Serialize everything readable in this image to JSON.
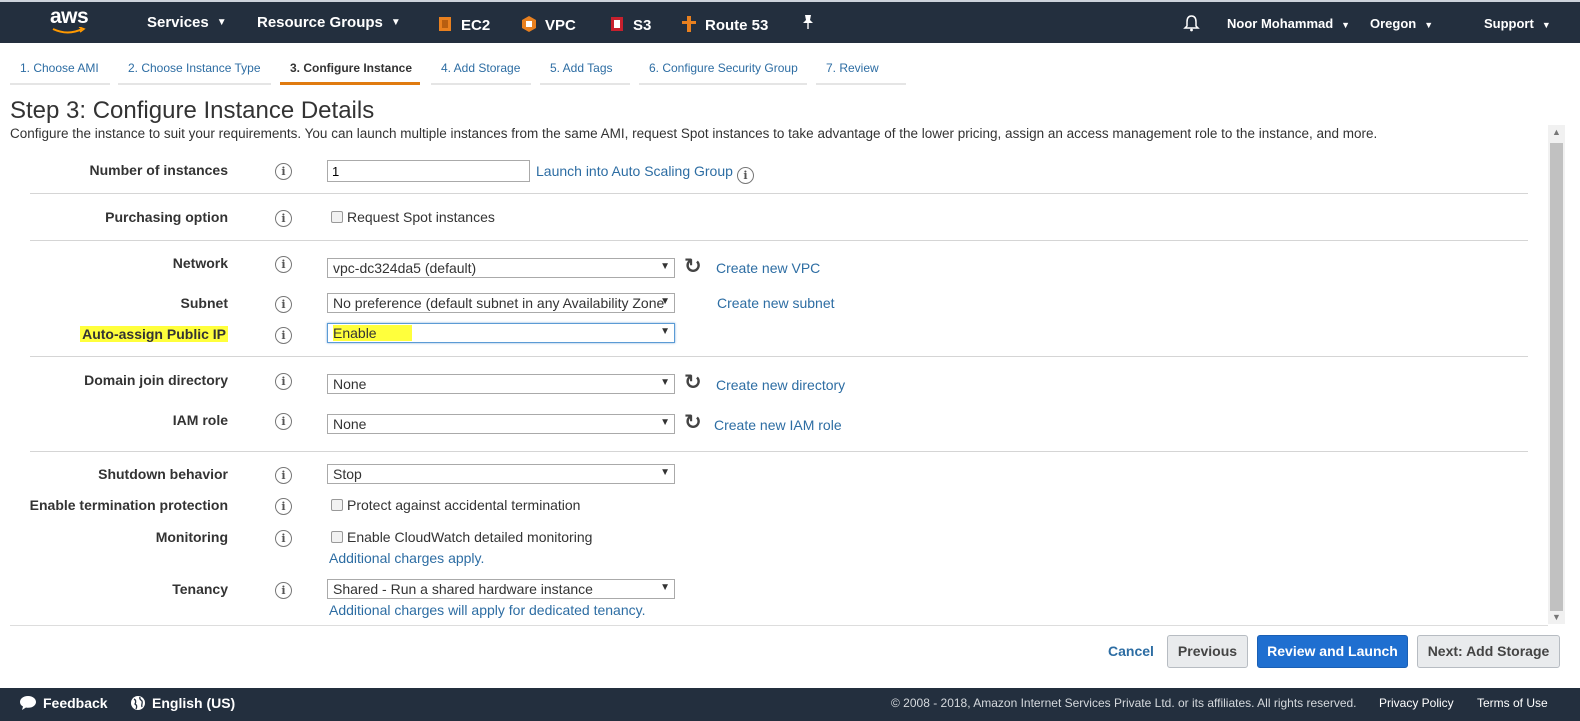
{
  "topnav": {
    "logo": "aws",
    "services": "Services",
    "resource_groups": "Resource Groups",
    "ec2": "EC2",
    "vpc": "VPC",
    "s3": "S3",
    "route53": "Route 53",
    "user": "Noor Mohammad",
    "region": "Oregon",
    "support": "Support",
    "icons": {
      "pin": "pin-icon",
      "bell": "bell-icon"
    }
  },
  "tabs": [
    "1. Choose AMI",
    "2. Choose Instance Type",
    "3. Configure Instance",
    "4. Add Storage",
    "5. Add Tags",
    "6. Configure Security Group",
    "7. Review"
  ],
  "page": {
    "title": "Step 3: Configure Instance Details",
    "description": "Configure the instance to suit your requirements. You can launch multiple instances from the same AMI, request Spot instances to take advantage of the lower pricing, assign an access management role to the instance, and more."
  },
  "form": {
    "num_instances": {
      "label": "Number of instances",
      "value": "1",
      "link": "Launch into Auto Scaling Group"
    },
    "purchasing": {
      "label": "Purchasing option",
      "checkbox": "Request Spot instances"
    },
    "network": {
      "label": "Network",
      "value": "vpc-dc324da5 (default)",
      "link": "Create new VPC"
    },
    "subnet": {
      "label": "Subnet",
      "value": "No preference (default subnet in any Availability Zone",
      "link": "Create new subnet"
    },
    "public_ip": {
      "label": "Auto-assign Public IP",
      "value": "Enable"
    },
    "domain": {
      "label": "Domain join directory",
      "value": "None",
      "link": "Create new directory"
    },
    "iam": {
      "label": "IAM role",
      "value": "None",
      "link": "Create new IAM role"
    },
    "shutdown": {
      "label": "Shutdown behavior",
      "value": "Stop"
    },
    "termination": {
      "label": "Enable termination protection",
      "checkbox": "Protect against accidental termination"
    },
    "monitoring": {
      "label": "Monitoring",
      "checkbox": "Enable CloudWatch detailed monitoring",
      "note": "Additional charges apply."
    },
    "tenancy": {
      "label": "Tenancy",
      "value": "Shared - Run a shared hardware instance",
      "note": "Additional charges will apply for dedicated tenancy."
    }
  },
  "actions": {
    "cancel": "Cancel",
    "previous": "Previous",
    "review": "Review and Launch",
    "next": "Next: Add Storage"
  },
  "footer": {
    "feedback": "Feedback",
    "language": "English (US)",
    "copyright": "© 2008 - 2018, Amazon Internet Services Private Ltd. or its affiliates. All rights reserved.",
    "privacy": "Privacy Policy",
    "terms": "Terms of Use"
  },
  "colors": {
    "nav_bg": "#232f3e",
    "accent": "#e07b10",
    "link": "#2d6da3",
    "primary_btn": "#1f6fd0",
    "highlight": "#ffff3c"
  }
}
